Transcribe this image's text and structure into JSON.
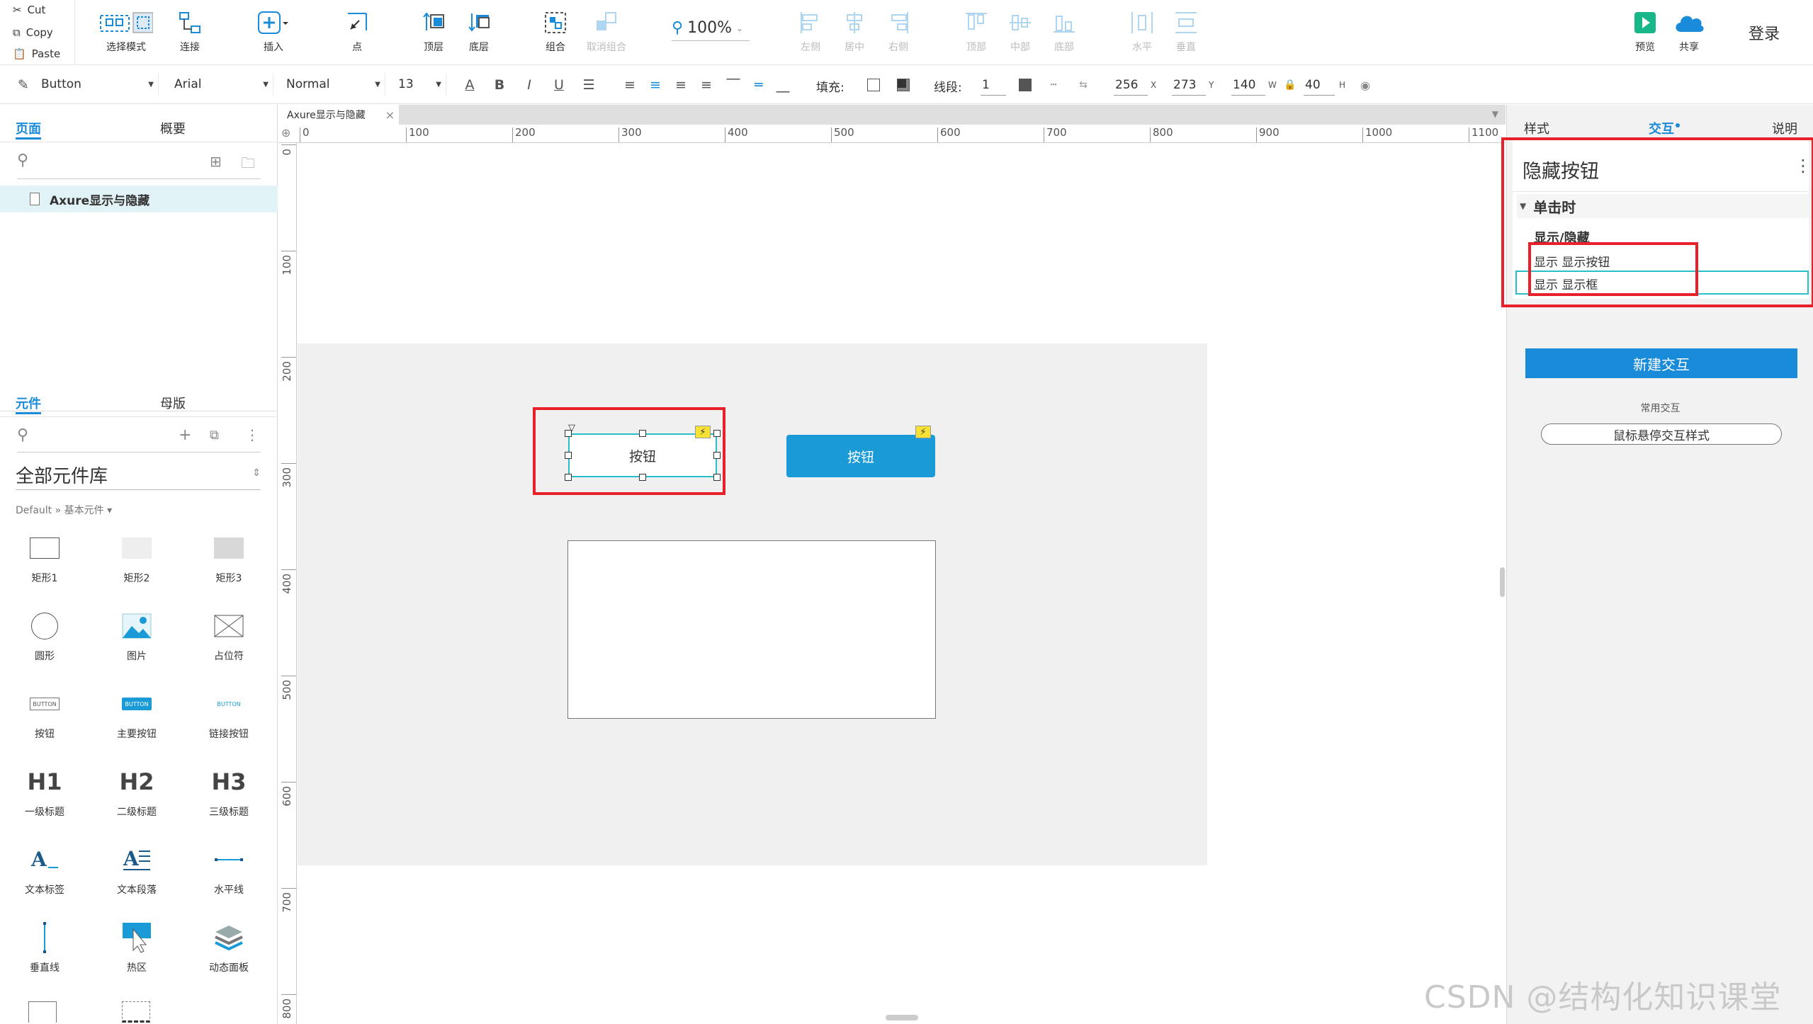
{
  "clipboard": {
    "cut": "Cut",
    "copy": "Copy",
    "paste": "Paste"
  },
  "toolbar": {
    "select_mode": "选择模式",
    "connect": "连接",
    "insert": "插入",
    "point": "点",
    "top_layer": "顶层",
    "bottom_layer": "底层",
    "group": "组合",
    "ungroup": "取消组合",
    "zoom": "100%",
    "align_left": "左侧",
    "align_center": "居中",
    "align_right": "右侧",
    "align_top": "顶部",
    "align_middle": "中部",
    "align_bottom": "底部",
    "dist_h": "水平",
    "dist_v": "垂直",
    "preview": "预览",
    "share": "共享",
    "login": "登录"
  },
  "format": {
    "widget_type": "Button",
    "font": "Arial",
    "weight": "Normal",
    "size": "13",
    "fill_label": "填充:",
    "stroke_label": "线段:",
    "stroke_value": "1",
    "x": "256",
    "x_unit": "X",
    "y": "273",
    "y_unit": "Y",
    "w": "140",
    "w_unit": "W",
    "h": "40",
    "h_unit": "H"
  },
  "left": {
    "tab_pages": "页面",
    "tab_outline": "概要",
    "page_name": "Axure显示与隐藏",
    "tab_widgets": "元件",
    "tab_masters": "母版",
    "library": "全部元件库",
    "library_path": "Default » 基本元件 ▾",
    "widgets": [
      "矩形1",
      "矩形2",
      "矩形3",
      "圆形",
      "图片",
      "占位符",
      "按钮",
      "主要按钮",
      "链接按钮",
      "一级标题",
      "二级标题",
      "三级标题",
      "文本标签",
      "文本段落",
      "水平线",
      "垂直线",
      "热区",
      "动态面板"
    ],
    "widget_button_text": "BUTTON",
    "h1": "H1",
    "h2": "H2",
    "h3": "H3"
  },
  "canvas": {
    "doc_tab": "Axure显示与隐藏",
    "ruler_top": [
      "0",
      "100",
      "200",
      "300",
      "400",
      "500",
      "600",
      "700",
      "800",
      "900",
      "1000",
      "1100"
    ],
    "ruler_left": [
      "0",
      "100",
      "200",
      "300",
      "400",
      "500",
      "600",
      "700",
      "800"
    ],
    "hidden_button_label": "按钮",
    "shown_button_label": "按钮"
  },
  "right": {
    "tab_style": "样式",
    "tab_interaction": "交互",
    "tab_notes": "说明",
    "widget_name": "隐藏按钮",
    "event": "单击时",
    "action": "显示/隐藏",
    "targets": [
      "显示 显示按钮",
      "显示 显示框"
    ],
    "new_interaction": "新建交互",
    "common": "常用交互",
    "hover_style": "鼠标悬停交互样式"
  },
  "watermark": "CSDN @结构化知识课堂",
  "colors": {
    "accent": "#1a8bd9",
    "selection": "#e8202a",
    "teal": "#28bfc8"
  }
}
